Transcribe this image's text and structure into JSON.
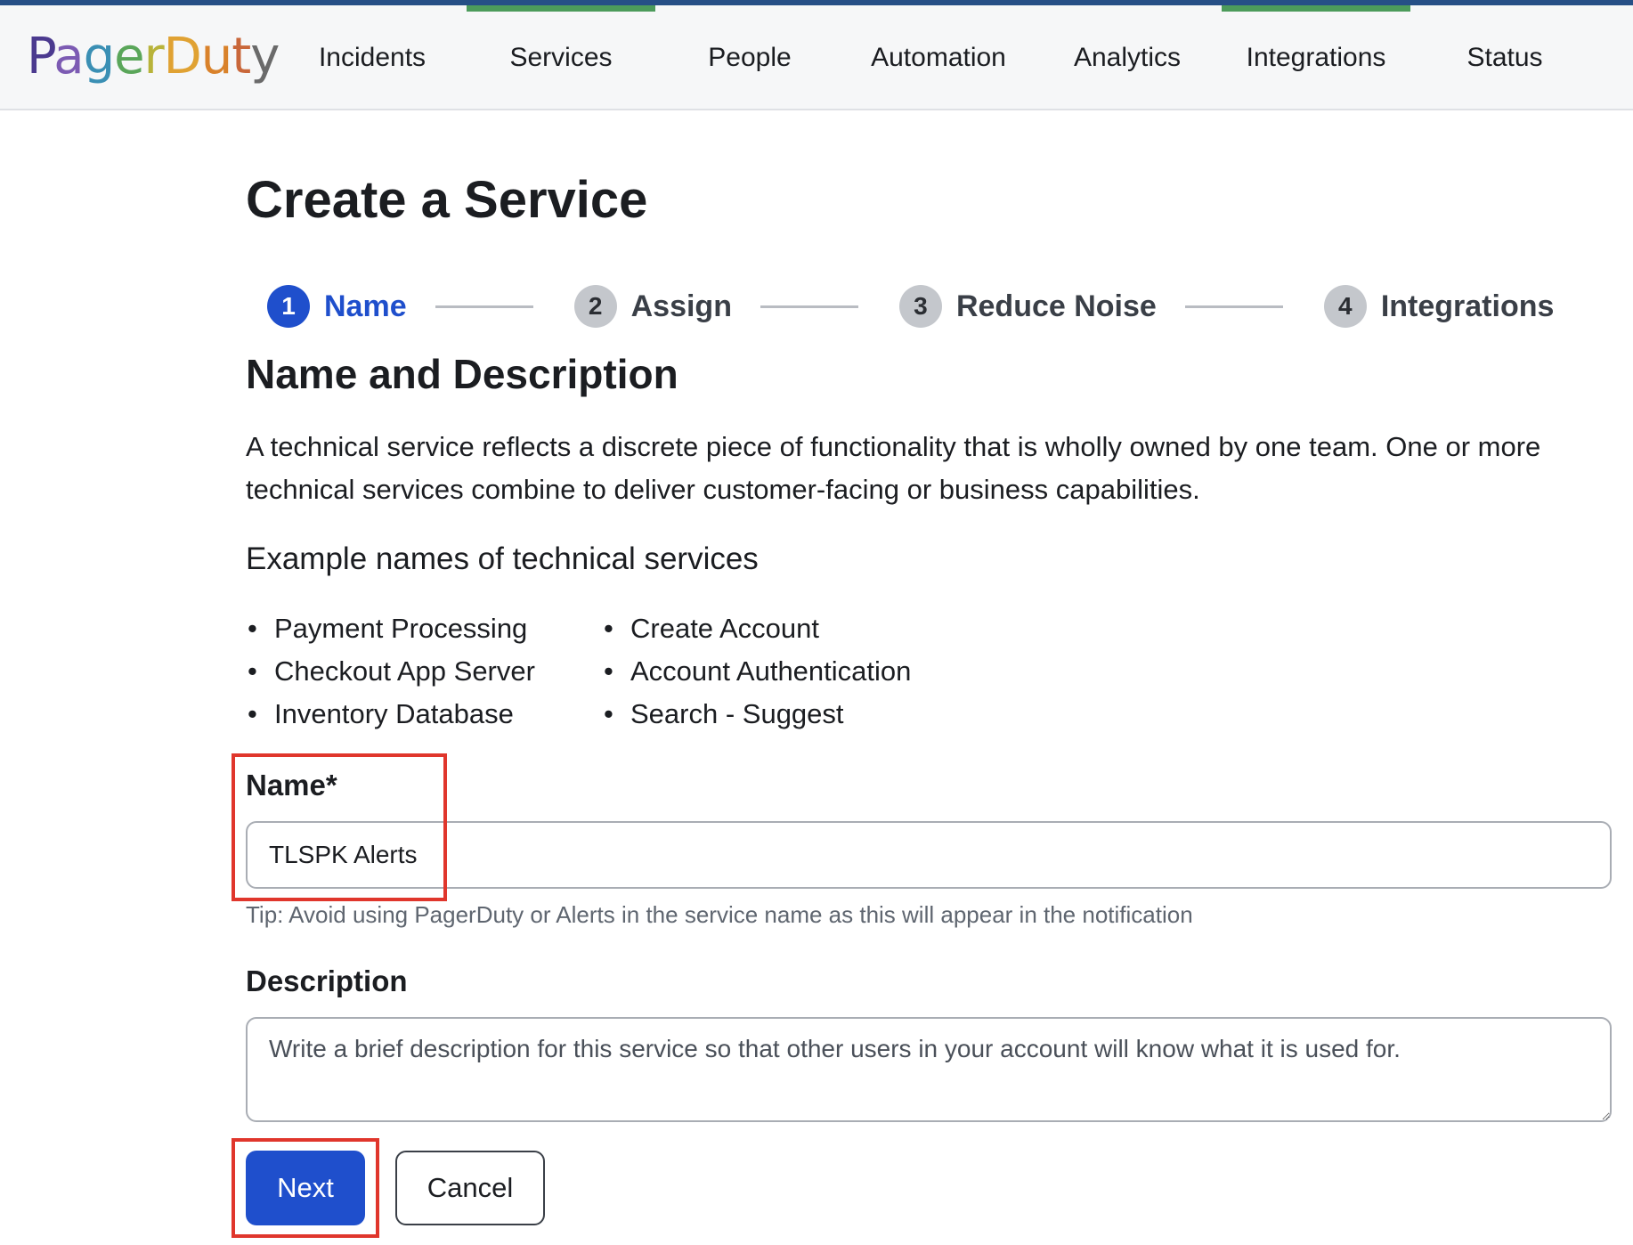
{
  "header": {
    "logo_text": "PagerDuty",
    "logo_letters": [
      {
        "char": "P",
        "color": "#4b3a8f"
      },
      {
        "char": "a",
        "color": "#7c5bb3"
      },
      {
        "char": "g",
        "color": "#3a8fb4"
      },
      {
        "char": "e",
        "color": "#5aa65a"
      },
      {
        "char": "r",
        "color": "#b8b33a"
      },
      {
        "char": "D",
        "color": "#e0a233"
      },
      {
        "char": "u",
        "color": "#d9822b"
      },
      {
        "char": "t",
        "color": "#c9673a"
      },
      {
        "char": "y",
        "color": "#6a6a6a"
      }
    ],
    "nav": [
      {
        "label": "Incidents",
        "active": false
      },
      {
        "label": "Services",
        "active": true
      },
      {
        "label": "People",
        "active": false
      },
      {
        "label": "Automation",
        "active": false
      },
      {
        "label": "Analytics",
        "active": false
      },
      {
        "label": "Integrations",
        "active": true
      },
      {
        "label": "Status",
        "active": false
      }
    ]
  },
  "page": {
    "title": "Create a Service",
    "steps": [
      {
        "number": "1",
        "label": "Name",
        "active": true
      },
      {
        "number": "2",
        "label": "Assign",
        "active": false
      },
      {
        "number": "3",
        "label": "Reduce Noise",
        "active": false
      },
      {
        "number": "4",
        "label": "Integrations",
        "active": false
      }
    ],
    "section_title": "Name and Description",
    "intro": "A technical service reflects a discrete piece of functionality that is wholly owned by one team. One or more technical services combine to deliver customer-facing or business capabilities.",
    "examples_title": "Example names of technical services",
    "examples_left": [
      "Payment Processing",
      "Checkout App Server",
      "Inventory Database"
    ],
    "examples_right": [
      "Create Account",
      "Account Authentication",
      "Search - Suggest"
    ],
    "name_label": "Name*",
    "name_value": "TLSPK Alerts",
    "tip": "Tip: Avoid using PagerDuty or Alerts in the service name as this will appear in the notification",
    "description_label": "Description",
    "description_placeholder": "Write a brief description for this service so that other users in your account will know what it is used for.",
    "next_label": "Next",
    "cancel_label": "Cancel"
  },
  "colors": {
    "accent_blue": "#1f4fcc",
    "nav_active_bar": "#4c9b5b",
    "highlight_red": "#e0362c",
    "top_strip": "#264f86"
  }
}
